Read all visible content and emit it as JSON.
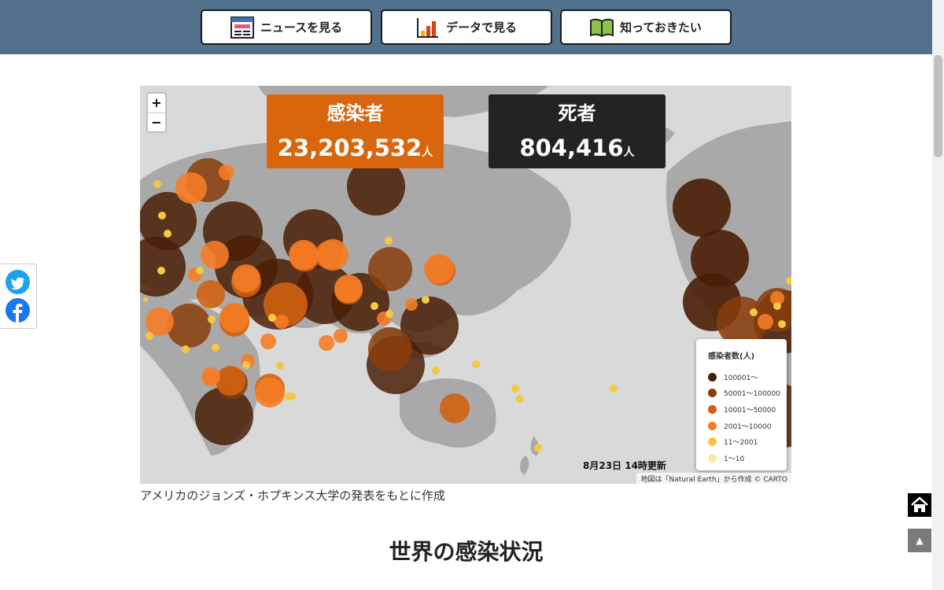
{
  "nav": {
    "news_label": "ニュースを見る",
    "data_label": "データで見る",
    "know_label": "知っておきたい"
  },
  "map": {
    "zoom_in": "+",
    "zoom_out": "−",
    "infected": {
      "label": "感染者",
      "value": "23,203,532",
      "unit": "人"
    },
    "deaths": {
      "label": "死者",
      "value": "804,416",
      "unit": "人"
    },
    "legend": {
      "title": "感染者数(人)",
      "items": [
        {
          "label": "100001〜",
          "color": "#4a1e05"
        },
        {
          "label": "50001〜100000",
          "color": "#8a3d0a"
        },
        {
          "label": "10001〜50000",
          "color": "#d0600f"
        },
        {
          "label": "2001〜10000",
          "color": "#f57c26"
        },
        {
          "label": "11〜2001",
          "color": "#f5c842"
        },
        {
          "label": "1〜10",
          "color": "#fbe9a0"
        }
      ]
    },
    "updated": "8月23日 14時更新",
    "attribution": "地図は「Natural Earth」から作成 © CARTO"
  },
  "caption": "アメリカのジョンズ・ホプキンス大学の発表をもとに作成",
  "section_title": "世界の感染状況",
  "buttons": {
    "top": "▲"
  }
}
